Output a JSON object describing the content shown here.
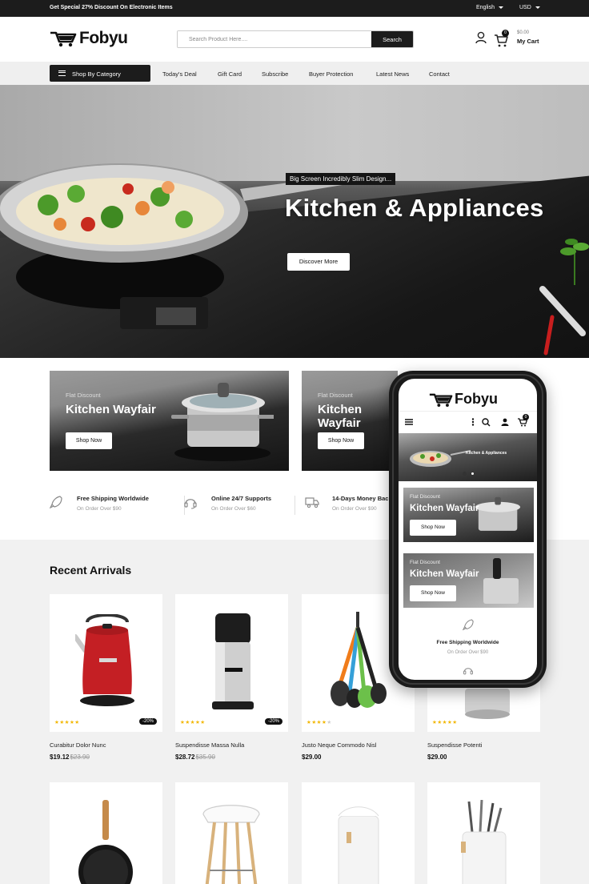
{
  "topbar": {
    "promo": "Get Special 27% Discount On Electronic Items",
    "language": "English",
    "currency": "USD"
  },
  "header": {
    "logo": "Fobyu",
    "search_placeholder": "Search Product Here....",
    "search_button": "Search",
    "cart_count": "0",
    "cart_amount": "$0.00",
    "cart_label": "My Cart"
  },
  "nav": {
    "category_button": "Shop By Category",
    "links": [
      "Today's Deal",
      "Gift Card",
      "Subscribe",
      "Buyer Protection",
      "Latest News",
      "Contact"
    ]
  },
  "hero": {
    "tagline": "Big Screen Incredibly Slim Design...",
    "title": "Kitchen & Appliances",
    "cta": "Discover More"
  },
  "banners": [
    {
      "small": "Flat Discount",
      "title": "Kitchen Wayfair",
      "cta": "Shop Now"
    },
    {
      "small": "Flat Discount",
      "title": "Kitchen Wayfair",
      "cta": "Shop Now"
    }
  ],
  "features": [
    {
      "icon": "rocket-icon",
      "title": "Free Shipping Worldwide",
      "sub": "On Order Over $90"
    },
    {
      "icon": "headset-icon",
      "title": "Online 24/7 Supports",
      "sub": "On Order Over $60"
    },
    {
      "icon": "truck-icon",
      "title": "14-Days Money Back",
      "sub": "On Order Over $90"
    }
  ],
  "section_title": "Recent Arrivals",
  "products": [
    {
      "name": "Curabitur Dolor Nunc",
      "price": "$19.12",
      "old_price": "$23.90",
      "rating": 5,
      "discount": "-20%"
    },
    {
      "name": "Suspendisse Massa Nulla",
      "price": "$28.72",
      "old_price": "$35.90",
      "rating": 5,
      "discount": "-20%"
    },
    {
      "name": "Justo Neque Commodo Nisl",
      "price": "$29.00",
      "old_price": "",
      "rating": 4,
      "discount": ""
    },
    {
      "name": "Suspendisse Potenti",
      "price": "$29.00",
      "old_price": "",
      "rating": 5,
      "discount": ""
    }
  ],
  "phone": {
    "logo": "Fobyu",
    "cart_count": "0",
    "slide_title": "Kitchen & Appliances",
    "banners": [
      {
        "small": "Flat Discount",
        "title": "Kitchen Wayfair",
        "cta": "Shop Now"
      },
      {
        "small": "Flat Discount",
        "title": "Kitchen Wayfair",
        "cta": "Shop Now"
      }
    ],
    "feature_title": "Free Shipping Worldwide",
    "feature_sub": "On Order Over $90"
  },
  "colors": {
    "dark": "#1c1c1c",
    "nav_bg": "#efefef",
    "section_bg": "#f1f1f1",
    "star": "#f2b600"
  }
}
